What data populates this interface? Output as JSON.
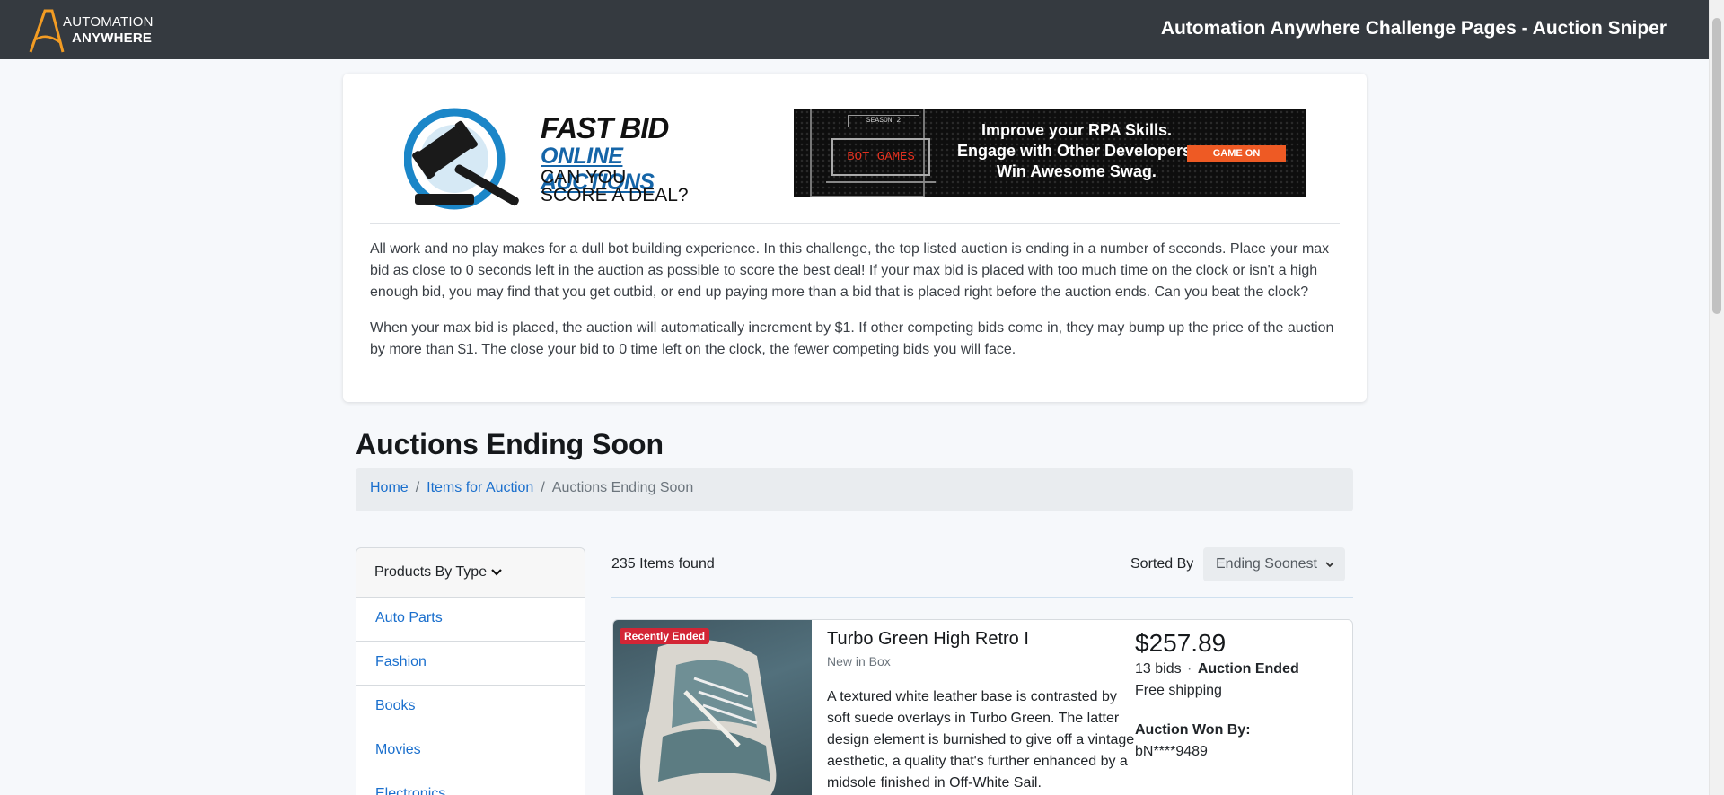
{
  "header": {
    "brand_line1": "AUTOMATION",
    "brand_line2": "ANYWHERE",
    "title": "Automation Anywhere Challenge Pages - Auction Sniper"
  },
  "intro": {
    "logo": {
      "line1": "FAST BID",
      "line2": "ONLINE AUCTIONS",
      "line3": "CAN YOU",
      "line4": "SCORE A DEAL?"
    },
    "banner": {
      "season": "SEASON 2",
      "screen_text": "BOT GAMES",
      "line1": "Improve your RPA Skills.",
      "line2": "Engage with Other Developers.",
      "line3": "Win Awesome Swag.",
      "button": "GAME ON"
    },
    "paragraph1": "All work and no play makes for a dull bot building experience. In this challenge, the top listed auction is ending in a number of seconds. Place your max bid as close to 0 seconds left in the auction as possible to score the best deal! If your max bid is placed with too much time on the clock or isn't a high enough bid, you may find that you get outbid, or end up paying more than a bid that is placed right before the auction ends. Can you beat the clock?",
    "paragraph2": "When your max bid is placed, the auction will automatically increment by $1. If other competing bids come in, they may bump up the price of the auction by more than $1. The close your bid to 0 time left on the clock, the fewer competing bids you will face."
  },
  "page": {
    "title": "Auctions Ending Soon",
    "breadcrumb": [
      "Home",
      "Items for Auction",
      "Auctions Ending Soon"
    ]
  },
  "sidebar": {
    "header": "Products By Type",
    "items": [
      "Auto Parts",
      "Fashion",
      "Books",
      "Movies",
      "Electronics"
    ]
  },
  "results": {
    "count": "235 Items found",
    "sorted_label": "Sorted By",
    "sort_value": "Ending Soonest"
  },
  "items": [
    {
      "badge": "Recently Ended",
      "title": "Turbo Green High Retro I",
      "condition": "New in Box",
      "description": "A textured white leather base is contrasted by soft suede overlays in Turbo Green. The latter design element is burnished to give off a vintage aesthetic, a quality that's further enhanced by a midsole finished in Off-White Sail.",
      "price": "$257.89",
      "bids": "13 bids",
      "status": "Auction Ended",
      "shipping": "Free shipping",
      "won_label": "Auction Won By:",
      "won_user": "bN****9489"
    }
  ],
  "colors": {
    "header_bg": "#353a40",
    "link": "#1a6fcd",
    "badge": "#d32535",
    "banner_accent": "#ee5a24"
  }
}
